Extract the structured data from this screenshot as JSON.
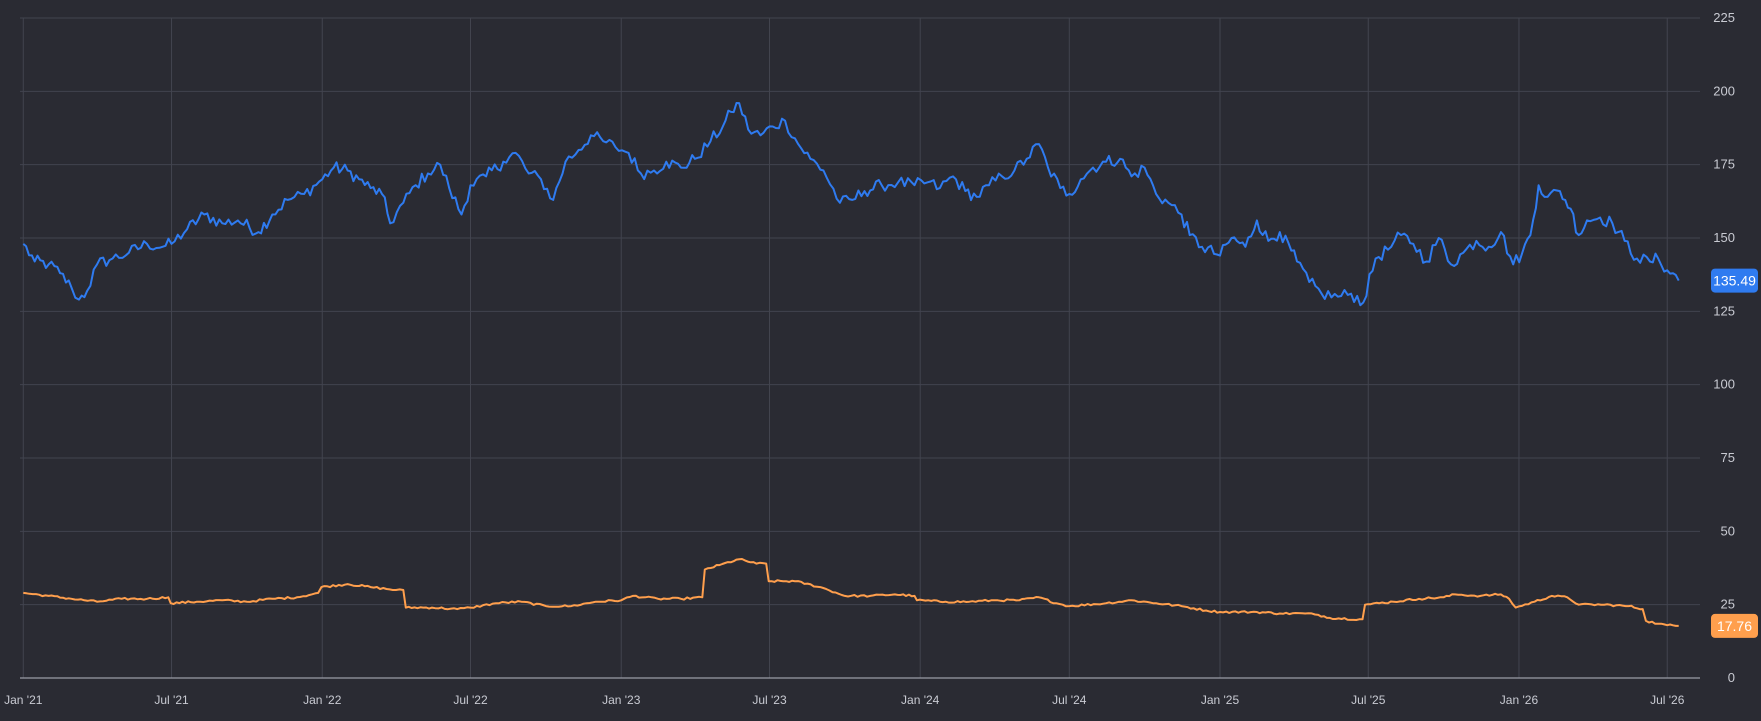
{
  "chart_data": {
    "type": "line",
    "title": "",
    "xlabel": "",
    "ylabel": "",
    "xlim": [
      "2020-12-28",
      "2026-08-10"
    ],
    "ylim": [
      0,
      225
    ],
    "y_ticks": [
      0,
      25,
      50,
      75,
      100,
      125,
      150,
      175,
      200,
      225
    ],
    "x_ticks": [
      {
        "date": "2021-01-01",
        "label": "Jan '21"
      },
      {
        "date": "2021-07-01",
        "label": "Jul '21"
      },
      {
        "date": "2022-01-01",
        "label": "Jan '22"
      },
      {
        "date": "2022-07-01",
        "label": "Jul '22"
      },
      {
        "date": "2023-01-01",
        "label": "Jan '23"
      },
      {
        "date": "2023-07-01",
        "label": "Jul '23"
      },
      {
        "date": "2024-01-01",
        "label": "Jan '24"
      },
      {
        "date": "2024-07-01",
        "label": "Jul '24"
      },
      {
        "date": "2025-01-01",
        "label": "Jan '25"
      },
      {
        "date": "2025-07-01",
        "label": "Jul '25"
      },
      {
        "date": "2026-01-01",
        "label": "Jan '26"
      },
      {
        "date": "2026-07-01",
        "label": "Jul '26"
      }
    ],
    "grid": true,
    "y_axis_position": "right",
    "series": [
      {
        "color": "#2f7bf0",
        "last_value_label": "135.49",
        "points": [
          [
            "2021-01-01",
            148
          ],
          [
            "2021-01-15",
            142
          ],
          [
            "2021-02-01",
            141
          ],
          [
            "2021-02-15",
            138
          ],
          [
            "2021-03-01",
            133
          ],
          [
            "2021-03-10",
            129
          ],
          [
            "2021-03-20",
            132
          ],
          [
            "2021-04-01",
            141
          ],
          [
            "2021-04-20",
            143
          ],
          [
            "2021-05-10",
            145
          ],
          [
            "2021-06-01",
            148
          ],
          [
            "2021-06-20",
            147
          ],
          [
            "2021-07-01",
            148
          ],
          [
            "2021-07-20",
            153
          ],
          [
            "2021-08-10",
            158
          ],
          [
            "2021-09-01",
            155
          ],
          [
            "2021-09-20",
            156
          ],
          [
            "2021-10-15",
            152
          ],
          [
            "2021-11-01",
            158
          ],
          [
            "2021-11-20",
            163
          ],
          [
            "2021-12-10",
            165
          ],
          [
            "2022-01-01",
            170
          ],
          [
            "2022-01-15",
            174
          ],
          [
            "2022-02-01",
            173
          ],
          [
            "2022-02-15",
            170
          ],
          [
            "2022-03-01",
            167
          ],
          [
            "2022-03-15",
            165
          ],
          [
            "2022-03-25",
            155
          ],
          [
            "2022-04-10",
            162
          ],
          [
            "2022-04-25",
            168
          ],
          [
            "2022-05-10",
            172
          ],
          [
            "2022-05-25",
            175
          ],
          [
            "2022-06-05",
            167
          ],
          [
            "2022-06-20",
            158
          ],
          [
            "2022-07-01",
            168
          ],
          [
            "2022-07-20",
            171
          ],
          [
            "2022-08-10",
            176
          ],
          [
            "2022-08-25",
            179
          ],
          [
            "2022-09-10",
            172
          ],
          [
            "2022-09-25",
            170
          ],
          [
            "2022-10-10",
            163
          ],
          [
            "2022-10-25",
            176
          ],
          [
            "2022-11-10",
            180
          ],
          [
            "2022-11-25",
            185
          ],
          [
            "2022-12-10",
            183
          ],
          [
            "2022-12-25",
            181
          ],
          [
            "2023-01-10",
            179
          ],
          [
            "2023-01-25",
            172
          ],
          [
            "2023-02-10",
            173
          ],
          [
            "2023-02-25",
            176
          ],
          [
            "2023-03-15",
            174
          ],
          [
            "2023-04-01",
            177
          ],
          [
            "2023-04-20",
            183
          ],
          [
            "2023-05-05",
            188
          ],
          [
            "2023-05-15",
            193
          ],
          [
            "2023-05-25",
            196
          ],
          [
            "2023-06-05",
            187
          ],
          [
            "2023-06-20",
            185
          ],
          [
            "2023-07-05",
            188
          ],
          [
            "2023-07-20",
            190
          ],
          [
            "2023-08-05",
            182
          ],
          [
            "2023-08-20",
            177
          ],
          [
            "2023-09-05",
            173
          ],
          [
            "2023-09-25",
            162
          ],
          [
            "2023-10-10",
            163
          ],
          [
            "2023-10-25",
            166
          ],
          [
            "2023-11-15",
            168
          ],
          [
            "2023-12-05",
            169
          ],
          [
            "2023-12-25",
            168
          ],
          [
            "2024-01-10",
            169
          ],
          [
            "2024-01-25",
            167
          ],
          [
            "2024-02-10",
            171
          ],
          [
            "2024-02-25",
            166
          ],
          [
            "2024-03-10",
            164
          ],
          [
            "2024-03-25",
            168
          ],
          [
            "2024-04-10",
            171
          ],
          [
            "2024-04-25",
            173
          ],
          [
            "2024-05-10",
            177
          ],
          [
            "2024-05-25",
            182
          ],
          [
            "2024-06-05",
            174
          ],
          [
            "2024-06-20",
            167
          ],
          [
            "2024-07-01",
            165
          ],
          [
            "2024-07-15",
            170
          ],
          [
            "2024-07-30",
            174
          ],
          [
            "2024-08-15",
            176
          ],
          [
            "2024-09-01",
            177
          ],
          [
            "2024-09-15",
            171
          ],
          [
            "2024-10-01",
            174
          ],
          [
            "2024-10-15",
            165
          ],
          [
            "2024-10-30",
            162
          ],
          [
            "2024-11-15",
            158
          ],
          [
            "2024-11-25",
            151
          ],
          [
            "2024-12-10",
            147
          ],
          [
            "2025-01-01",
            144
          ],
          [
            "2025-01-15",
            150
          ],
          [
            "2025-02-01",
            147
          ],
          [
            "2025-02-15",
            156
          ],
          [
            "2025-03-01",
            149
          ],
          [
            "2025-03-15",
            152
          ],
          [
            "2025-04-05",
            142
          ],
          [
            "2025-04-20",
            135
          ],
          [
            "2025-05-05",
            131
          ],
          [
            "2025-05-25",
            130
          ],
          [
            "2025-06-10",
            131
          ],
          [
            "2025-06-25",
            128
          ],
          [
            "2025-07-10",
            143
          ],
          [
            "2025-07-25",
            146
          ],
          [
            "2025-08-10",
            151
          ],
          [
            "2025-08-25",
            148
          ],
          [
            "2025-09-10",
            142
          ],
          [
            "2025-09-25",
            150
          ],
          [
            "2025-10-10",
            141
          ],
          [
            "2025-10-25",
            145
          ],
          [
            "2025-11-10",
            149
          ],
          [
            "2025-11-25",
            147
          ],
          [
            "2025-12-10",
            152
          ],
          [
            "2025-12-25",
            141
          ],
          [
            "2026-01-05",
            145
          ],
          [
            "2026-01-15",
            151
          ],
          [
            "2026-01-25",
            168
          ],
          [
            "2026-02-05",
            164
          ],
          [
            "2026-02-20",
            166
          ],
          [
            "2026-03-05",
            160
          ],
          [
            "2026-03-15",
            151
          ],
          [
            "2026-03-25",
            156
          ],
          [
            "2026-04-10",
            157
          ],
          [
            "2026-04-25",
            155
          ],
          [
            "2026-05-10",
            149
          ],
          [
            "2026-05-25",
            143
          ],
          [
            "2026-06-10",
            142
          ],
          [
            "2026-06-20",
            143
          ],
          [
            "2026-07-01",
            139
          ],
          [
            "2026-07-08",
            138
          ],
          [
            "2026-07-15",
            135.49
          ]
        ]
      },
      {
        "color": "#ff9f4d",
        "last_value_label": "17.76",
        "points": [
          [
            "2021-01-01",
            29
          ],
          [
            "2021-02-01",
            28
          ],
          [
            "2021-03-01",
            27
          ],
          [
            "2021-04-01",
            26
          ],
          [
            "2021-05-01",
            27
          ],
          [
            "2021-06-01",
            27
          ],
          [
            "2021-06-27",
            27.5
          ],
          [
            "2021-06-30",
            25.5
          ],
          [
            "2021-08-01",
            26
          ],
          [
            "2021-09-01",
            26.5
          ],
          [
            "2021-10-01",
            26
          ],
          [
            "2021-11-01",
            27
          ],
          [
            "2021-12-01",
            27.5
          ],
          [
            "2021-12-27",
            29
          ],
          [
            "2021-12-31",
            31
          ],
          [
            "2022-02-01",
            32
          ],
          [
            "2022-03-01",
            31
          ],
          [
            "2022-04-01",
            30
          ],
          [
            "2022-04-10",
            30
          ],
          [
            "2022-04-13",
            24
          ],
          [
            "2022-05-15",
            24
          ],
          [
            "2022-06-15",
            23.5
          ],
          [
            "2022-07-01",
            24
          ],
          [
            "2022-08-01",
            25.5
          ],
          [
            "2022-09-01",
            26
          ],
          [
            "2022-10-01",
            24.5
          ],
          [
            "2022-11-01",
            24.5
          ],
          [
            "2022-12-01",
            26
          ],
          [
            "2023-01-01",
            26.5
          ],
          [
            "2023-01-15",
            28
          ],
          [
            "2023-02-15",
            27
          ],
          [
            "2023-03-15",
            27
          ],
          [
            "2023-04-10",
            27.5
          ],
          [
            "2023-04-13",
            37
          ],
          [
            "2023-05-01",
            38.5
          ],
          [
            "2023-05-25",
            40.5
          ],
          [
            "2023-06-15",
            39
          ],
          [
            "2023-06-27",
            39
          ],
          [
            "2023-06-30",
            33
          ],
          [
            "2023-08-01",
            33
          ],
          [
            "2023-09-01",
            31
          ],
          [
            "2023-10-01",
            28
          ],
          [
            "2023-11-01",
            28
          ],
          [
            "2023-12-01",
            28.5
          ],
          [
            "2023-12-25",
            28
          ],
          [
            "2023-12-28",
            26.5
          ],
          [
            "2024-02-01",
            26
          ],
          [
            "2024-03-01",
            26
          ],
          [
            "2024-04-01",
            26.5
          ],
          [
            "2024-05-01",
            26.5
          ],
          [
            "2024-05-25",
            27.5
          ],
          [
            "2024-06-15",
            25.5
          ],
          [
            "2024-07-01",
            24.5
          ],
          [
            "2024-08-15",
            25.5
          ],
          [
            "2024-09-15",
            26.5
          ],
          [
            "2024-10-15",
            25.5
          ],
          [
            "2024-11-15",
            24.5
          ],
          [
            "2024-12-15",
            23
          ],
          [
            "2025-01-01",
            22.5
          ],
          [
            "2025-02-15",
            22.5
          ],
          [
            "2025-03-15",
            22
          ],
          [
            "2025-04-15",
            22
          ],
          [
            "2025-05-01",
            21.5
          ],
          [
            "2025-05-15",
            20.5
          ],
          [
            "2025-06-20",
            20
          ],
          [
            "2025-06-24",
            20
          ],
          [
            "2025-06-27",
            25
          ],
          [
            "2025-08-01",
            26
          ],
          [
            "2025-09-01",
            27
          ],
          [
            "2025-10-01",
            27.5
          ],
          [
            "2025-10-15",
            28.5
          ],
          [
            "2025-11-15",
            28
          ],
          [
            "2025-12-10",
            28.5
          ],
          [
            "2025-12-20",
            27
          ],
          [
            "2025-12-28",
            24
          ],
          [
            "2026-01-20",
            26
          ],
          [
            "2026-02-10",
            28
          ],
          [
            "2026-03-01",
            27.5
          ],
          [
            "2026-03-15",
            25
          ],
          [
            "2026-04-15",
            25
          ],
          [
            "2026-05-15",
            24.5
          ],
          [
            "2026-06-01",
            23.5
          ],
          [
            "2026-06-05",
            19.5
          ],
          [
            "2026-06-20",
            18.5
          ],
          [
            "2026-07-01",
            18
          ],
          [
            "2026-07-15",
            17.76
          ]
        ]
      }
    ]
  }
}
